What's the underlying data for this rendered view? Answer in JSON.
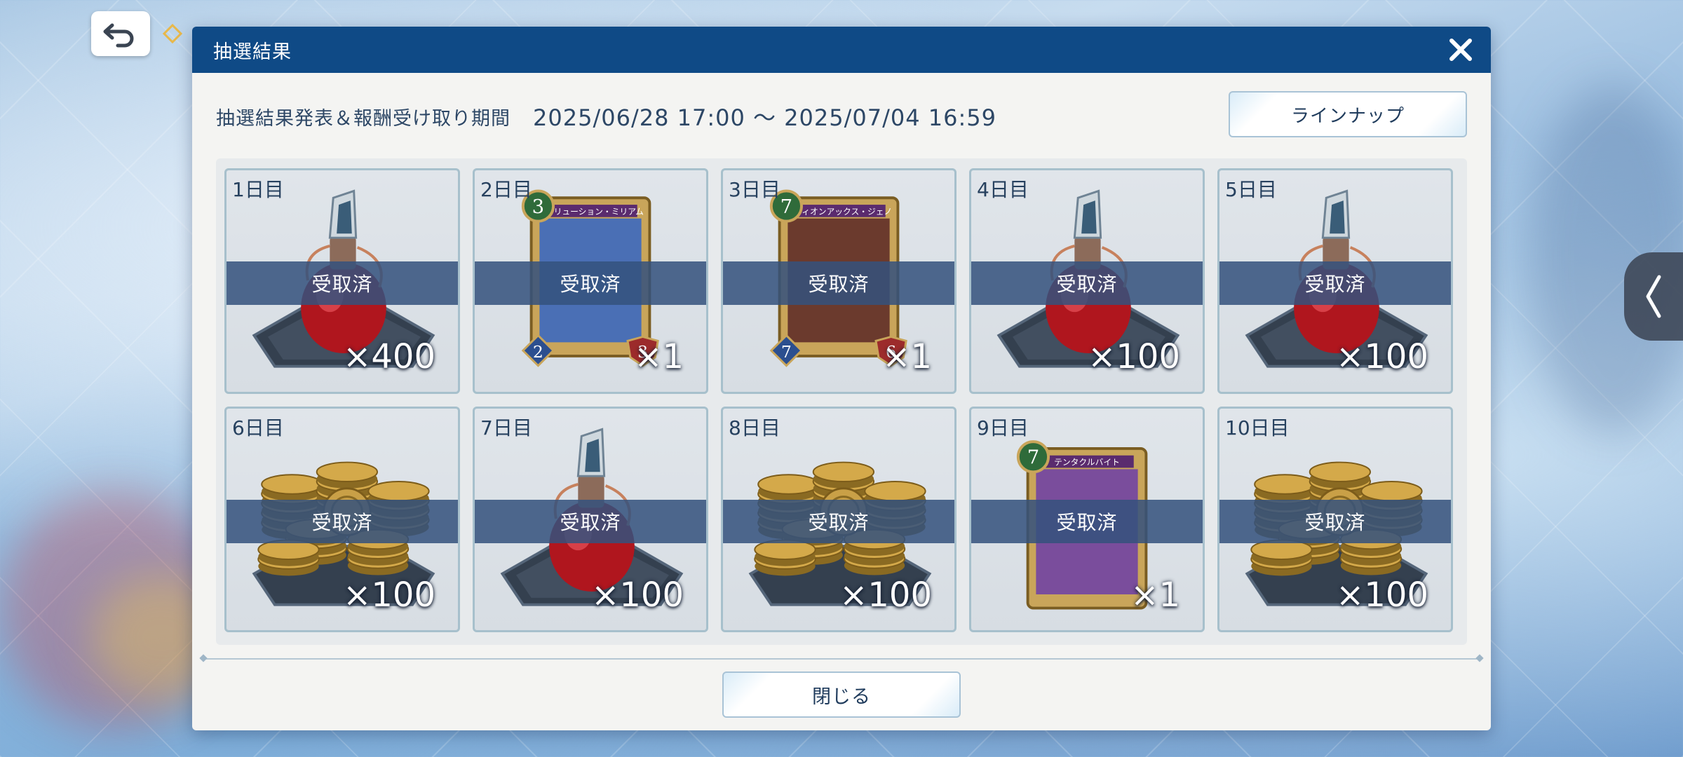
{
  "dialog": {
    "title": "抽選結果",
    "period_label": "抽選結果発表＆報酬受け取り期間",
    "period_value": "2025/06/28 17:00 〜 2025/07/04 16:59",
    "lineup_label": "ラインナップ",
    "close_label": "閉じる"
  },
  "rewards": [
    {
      "day": "1日目",
      "status": "受取済",
      "item": "potion-icon",
      "qty": "×400"
    },
    {
      "day": "2日目",
      "status": "受取済",
      "item": "card",
      "qty": "×1",
      "card": {
        "cost": "3",
        "name": "レゾリューション・ミリアム",
        "atk": "2",
        "def": "3",
        "art": "#4a6fb5"
      }
    },
    {
      "day": "3日目",
      "status": "受取済",
      "item": "card",
      "qty": "×1",
      "card": {
        "cost": "7",
        "name": "レヴィオンアックス・ジェノ",
        "atk": "7",
        "def": "6",
        "art": "#6b3a2d"
      }
    },
    {
      "day": "4日目",
      "status": "受取済",
      "item": "potion-icon",
      "qty": "×100"
    },
    {
      "day": "5日目",
      "status": "受取済",
      "item": "potion-icon",
      "qty": "×100"
    },
    {
      "day": "6日目",
      "status": "受取済",
      "item": "coin-stack-icon",
      "qty": "×100"
    },
    {
      "day": "7日目",
      "status": "受取済",
      "item": "potion-icon",
      "qty": "×100"
    },
    {
      "day": "8日目",
      "status": "受取済",
      "item": "coin-stack-icon",
      "qty": "×100"
    },
    {
      "day": "9日目",
      "status": "受取済",
      "item": "card",
      "qty": "×1",
      "card": {
        "cost": "7",
        "name": "テンタクルバイト",
        "atk": "",
        "def": "",
        "art": "#7a4d9c"
      }
    },
    {
      "day": "10日目",
      "status": "受取済",
      "item": "coin-stack-icon",
      "qty": "×100"
    }
  ],
  "colors": {
    "header": "#0f4a86",
    "band": "#34527d",
    "cost_badge": "#2f6b3a"
  }
}
